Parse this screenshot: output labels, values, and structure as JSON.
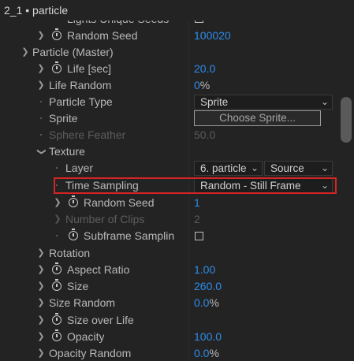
{
  "title": "2_1 • particle",
  "rows": {
    "lights_unique_seeds": {
      "label": "Lights Unique Seeds"
    },
    "random_seed_top": {
      "label": "Random Seed",
      "value": "100020"
    },
    "particle_master": {
      "label": "Particle (Master)"
    },
    "life": {
      "label": "Life [sec]",
      "value": "20.0"
    },
    "life_random": {
      "label": "Life Random",
      "value": "0",
      "unit": "%"
    },
    "particle_type": {
      "label": "Particle Type",
      "value": "Sprite"
    },
    "sprite": {
      "label": "Sprite",
      "button": "Choose Sprite..."
    },
    "sphere_feather": {
      "label": "Sphere Feather",
      "value": "50.0"
    },
    "texture": {
      "label": "Texture"
    },
    "layer": {
      "label": "Layer",
      "value": "6. particle",
      "source": "Source"
    },
    "time_sampling": {
      "label": "Time Sampling",
      "value": "Random - Still Frame"
    },
    "random_seed_tex": {
      "label": "Random Seed",
      "value": "1"
    },
    "number_of_clips": {
      "label": "Number of Clips",
      "value": "2"
    },
    "subframe_sampling": {
      "label": "Subframe Samplin"
    },
    "rotation": {
      "label": "Rotation"
    },
    "aspect_ratio": {
      "label": "Aspect Ratio",
      "value": "1.00"
    },
    "size": {
      "label": "Size",
      "value": "260.0"
    },
    "size_random": {
      "label": "Size Random",
      "value": "0.0",
      "unit": "%"
    },
    "size_over_life": {
      "label": "Size over Life"
    },
    "opacity": {
      "label": "Opacity",
      "value": "100.0"
    },
    "opacity_random": {
      "label": "Opacity Random",
      "value": "0.0",
      "unit": "%"
    }
  },
  "icons": {
    "expand": "chevron-right-icon",
    "collapse": "chevron-down-icon",
    "stopwatch": "stopwatch-icon",
    "dropdown": "dropdown-chevron-icon"
  },
  "colors": {
    "background": "#232323",
    "value_blue": "#2d8ceb",
    "highlight_red": "#d42424"
  }
}
